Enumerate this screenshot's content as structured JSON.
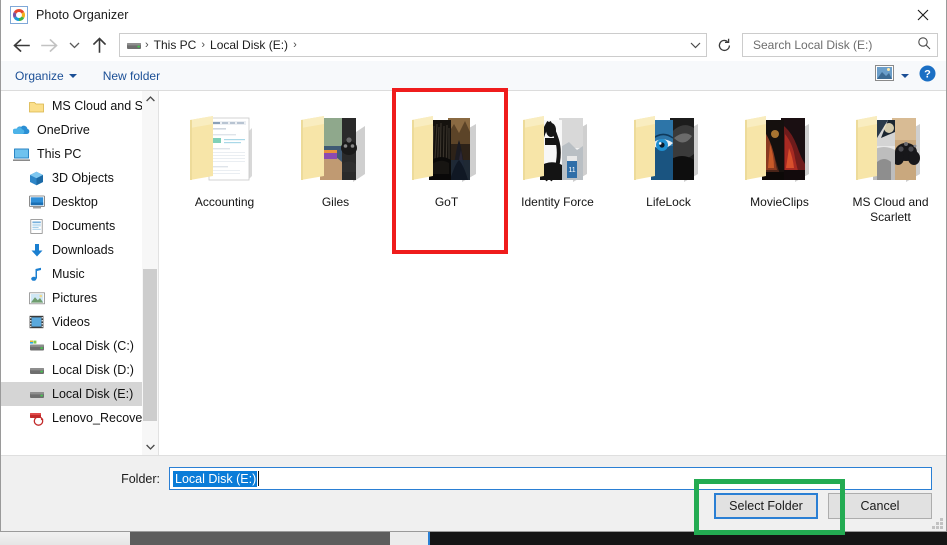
{
  "window": {
    "title": "Photo Organizer",
    "app_icon": "photo-organizer-icon",
    "close_label": "✕"
  },
  "nav": {
    "back_icon": "back-arrow-icon",
    "forward_icon": "forward-arrow-icon",
    "recent_icon": "recent-locations-chevron-icon",
    "up_icon": "up-arrow-icon",
    "address": {
      "drive_icon": "drive-icon",
      "crumbs": [
        "This PC",
        "Local Disk (E:)"
      ],
      "separator": "›",
      "dropdown_icon": "chevron-down-icon"
    },
    "refresh_icon": "refresh-icon",
    "search": {
      "placeholder": "Search Local Disk (E:)",
      "value": "",
      "icon": "search-icon"
    }
  },
  "commandbar": {
    "organize_label": "Organize",
    "new_folder_label": "New folder",
    "view_icon": "view-layout-icon",
    "view_dropdown_icon": "chevron-down-icon",
    "help_icon": "help-question-icon"
  },
  "sidebar": {
    "items": [
      {
        "label": "MS Cloud and S",
        "icon": "folder-icon",
        "level": 2,
        "selected": false,
        "truncated": true
      },
      {
        "label": "OneDrive",
        "icon": "onedrive-cloud-icon",
        "level": 1,
        "selected": false
      },
      {
        "label": "This PC",
        "icon": "this-pc-monitor-icon",
        "level": 1,
        "selected": false
      },
      {
        "label": "3D Objects",
        "icon": "3d-objects-icon",
        "level": 2,
        "selected": false
      },
      {
        "label": "Desktop",
        "icon": "desktop-icon",
        "level": 2,
        "selected": false
      },
      {
        "label": "Documents",
        "icon": "documents-icon",
        "level": 2,
        "selected": false
      },
      {
        "label": "Downloads",
        "icon": "downloads-arrow-icon",
        "level": 2,
        "selected": false
      },
      {
        "label": "Music",
        "icon": "music-note-icon",
        "level": 2,
        "selected": false
      },
      {
        "label": "Pictures",
        "icon": "pictures-icon",
        "level": 2,
        "selected": false
      },
      {
        "label": "Videos",
        "icon": "videos-film-icon",
        "level": 2,
        "selected": false
      },
      {
        "label": "Local Disk (C:)",
        "icon": "system-drive-icon",
        "level": 2,
        "selected": false
      },
      {
        "label": "Local Disk (D:)",
        "icon": "drive-icon",
        "level": 2,
        "selected": false
      },
      {
        "label": "Local Disk (E:)",
        "icon": "drive-icon",
        "level": 2,
        "selected": true
      },
      {
        "label": "Lenovo_Recover",
        "icon": "recovery-drive-icon",
        "level": 2,
        "selected": false,
        "truncated": true
      }
    ],
    "scrollbar": {
      "up_icon": "chevron-up-icon",
      "down_icon": "chevron-down-icon"
    }
  },
  "content": {
    "folders": [
      {
        "name": "Accounting",
        "thumb": "document-spreadsheet-preview"
      },
      {
        "name": "Giles",
        "thumb": "gamepad-photo-preview"
      },
      {
        "name": "GoT",
        "thumb": "iron-throne-photo-preview",
        "highlighted": true
      },
      {
        "name": "Identity Force",
        "thumb": "figure-bw-photo-preview"
      },
      {
        "name": "LifeLock",
        "thumb": "blue-eye-photo-preview"
      },
      {
        "name": "MovieClips",
        "thumb": "action-scene-photo-preview"
      },
      {
        "name": "MS Cloud and Scarlett",
        "thumb": "controller-photo-preview"
      }
    ]
  },
  "form": {
    "folder_label": "Folder:",
    "folder_value": "Local Disk (E:)",
    "folder_value_selected": true,
    "select_folder_label": "Select Folder",
    "cancel_label": "Cancel",
    "resize_grip_icon": "resize-grip-icon"
  },
  "annotations": [
    {
      "name": "red-highlight-box",
      "target": "GoT",
      "color": "#ef1c1c"
    },
    {
      "name": "green-highlight-box",
      "target": "Select Folder",
      "color": "#23ab52"
    }
  ]
}
